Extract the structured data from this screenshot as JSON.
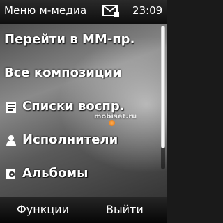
{
  "status_bar": {
    "title": "Меню м-медиа",
    "time": "23:09",
    "message_icon": "envelope-icon"
  },
  "menu": {
    "items": [
      {
        "label": "Перейти в ММ-пр.",
        "icon": null
      },
      {
        "label": "Все композиции",
        "icon": null
      },
      {
        "label": "Списки воспр.",
        "icon": "playlist-icon"
      },
      {
        "label": "Исполнители",
        "icon": "person-icon"
      },
      {
        "label": "Альбомы",
        "icon": "album-icon"
      }
    ],
    "scroll_position": 0.85
  },
  "watermark": "mobiset.ru",
  "softkeys": {
    "left": "Функции",
    "right": "Выйти"
  },
  "colors": {
    "text": "#ffffff",
    "bar_background": "#0e0e0e",
    "watermark_dot": "#e06a00"
  }
}
